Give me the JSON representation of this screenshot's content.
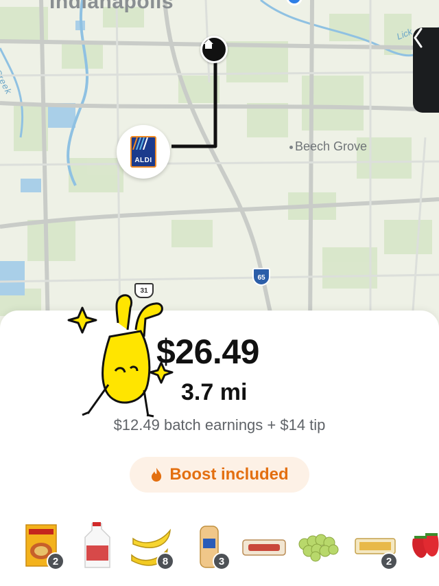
{
  "map": {
    "city_label": "Indianapolis",
    "place_label": "Beech Grove",
    "creek_label": "Creek",
    "lick_label": "Lick",
    "store_brand": "ALDI",
    "highway_65": "65",
    "highway_31": "31"
  },
  "offer": {
    "amount": "$26.49",
    "distance": "3.7 mi",
    "breakdown": "$12.49 batch earnings + $14 tip",
    "boost_label": "Boost included"
  },
  "items": [
    {
      "name": "pasta-kit",
      "count": "2"
    },
    {
      "name": "milk-gallon",
      "count": ""
    },
    {
      "name": "bananas",
      "count": "8"
    },
    {
      "name": "bread",
      "count": "3"
    },
    {
      "name": "cookies",
      "count": ""
    },
    {
      "name": "grapes",
      "count": ""
    },
    {
      "name": "cake-pack",
      "count": "2"
    },
    {
      "name": "strawberries",
      "count": ""
    }
  ],
  "colors": {
    "accent_orange": "#e36f10",
    "boost_bg": "#fdf1e6",
    "route": "#111111",
    "aldi_blue": "#1b3a8c"
  }
}
